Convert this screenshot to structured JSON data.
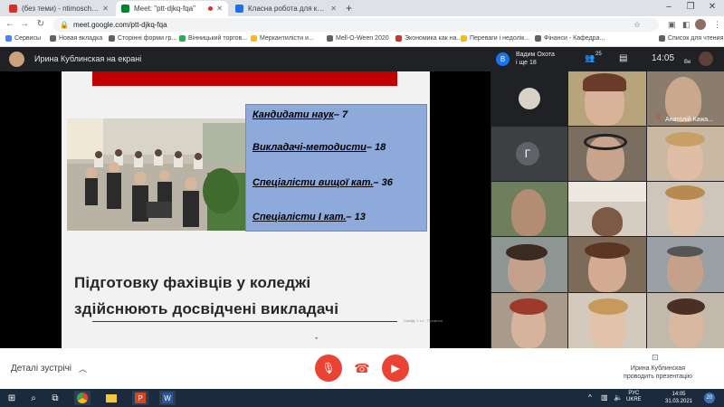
{
  "browser": {
    "tabs": [
      {
        "label": "(без теми) - ntimoschenkom@gma",
        "favicon_color": "#d93025",
        "active": false
      },
      {
        "label": "Meet: \"ptt-djkq-fqa\"",
        "favicon_color": "#00832d",
        "active": true
      },
      {
        "label": "Класна робота для курсу \"Банк",
        "favicon_color": "#1a73e8",
        "active": false
      }
    ],
    "new_tab": "+",
    "url": "meet.google.com/ptt-djkq-fqa",
    "bookmarks": [
      {
        "label": "Сервисы",
        "color": "#4285f4"
      },
      {
        "label": "Новая вкладка",
        "color": "#5f6368"
      },
      {
        "label": "Сторінні форми гр...",
        "color": "#5f6368"
      },
      {
        "label": "Вінницький торгов...",
        "color": "#34a853"
      },
      {
        "label": "Меркантилісти и...",
        "color": "#fbbc04"
      },
      {
        "label": "Mell-O-Ween 2020",
        "color": "#5f6368"
      },
      {
        "label": "Экономика как на...",
        "color": "#d93025"
      },
      {
        "label": "Переваги і недолік...",
        "color": "#fbbc04"
      },
      {
        "label": "Фінанси - Кафедра...",
        "color": "#5f6368"
      }
    ],
    "reading_list": "Список для чтения"
  },
  "meet": {
    "presenter_label": "Ирина Кублинская на екрані",
    "participants_name": "Вадим Охота",
    "participants_more": "і ще 18",
    "participants_count": "25",
    "clock": "14:05",
    "user_initial": "Ве"
  },
  "slide": {
    "stats": [
      {
        "label": "Кандидати наук",
        "value": "– 7"
      },
      {
        "label": "Викладачі-методисти",
        "value": "– 18"
      },
      {
        "label": "Спеціалісти вищої кат.",
        "value": "– 36"
      },
      {
        "label": "Спеціалісти  І  кат.",
        "value": "– 13"
      }
    ],
    "heading_line1": "Підготовку фахівців у коледжі",
    "heading_line2": "здійснюють досвідчені викладачі",
    "footnote": "Слайд: 1 з 1 · Примітки"
  },
  "tiles": [
    {
      "name": "",
      "bg": "#d9d2c7"
    },
    {
      "name": "",
      "bg": "#b7a47d"
    },
    {
      "name": "Анатолій Кажа...",
      "bg": "#8a7d6e"
    },
    {
      "name": "",
      "bg": "#3c4043",
      "initial": "Г",
      "avatar_bg": "#5f6368"
    },
    {
      "name": "",
      "bg": "#7a6e60"
    },
    {
      "name": "",
      "bg": "#c9b9a3"
    },
    {
      "name": "",
      "bg": "#6f7f5e"
    },
    {
      "name": "",
      "bg": "#d6cdc2"
    },
    {
      "name": "",
      "bg": "#cfc6bb"
    },
    {
      "name": "",
      "bg": "#8e9693"
    },
    {
      "name": "",
      "bg": "#7d6b5a"
    },
    {
      "name": "",
      "bg": "#9aa0a6"
    },
    {
      "name": "",
      "bg": "#a89b8b"
    },
    {
      "name": "",
      "bg": "#d3c9bd"
    },
    {
      "name": "",
      "bg": "#c2b8ab"
    }
  ],
  "bottom": {
    "meeting_details": "Деталі зустрічі",
    "presenting_name": "Ирина Кублинская",
    "presenting_text": "проводить презентацію"
  },
  "taskbar": {
    "lang": "РУС",
    "lang_sub": "UKRE",
    "time": "14:05",
    "date": "31.03.2021",
    "notif_count": "20"
  },
  "colors": {
    "meet_dark": "#202124",
    "end_red": "#ea4335",
    "slide_banner_red": "#c00000",
    "stats_box": "#8eaadb"
  }
}
